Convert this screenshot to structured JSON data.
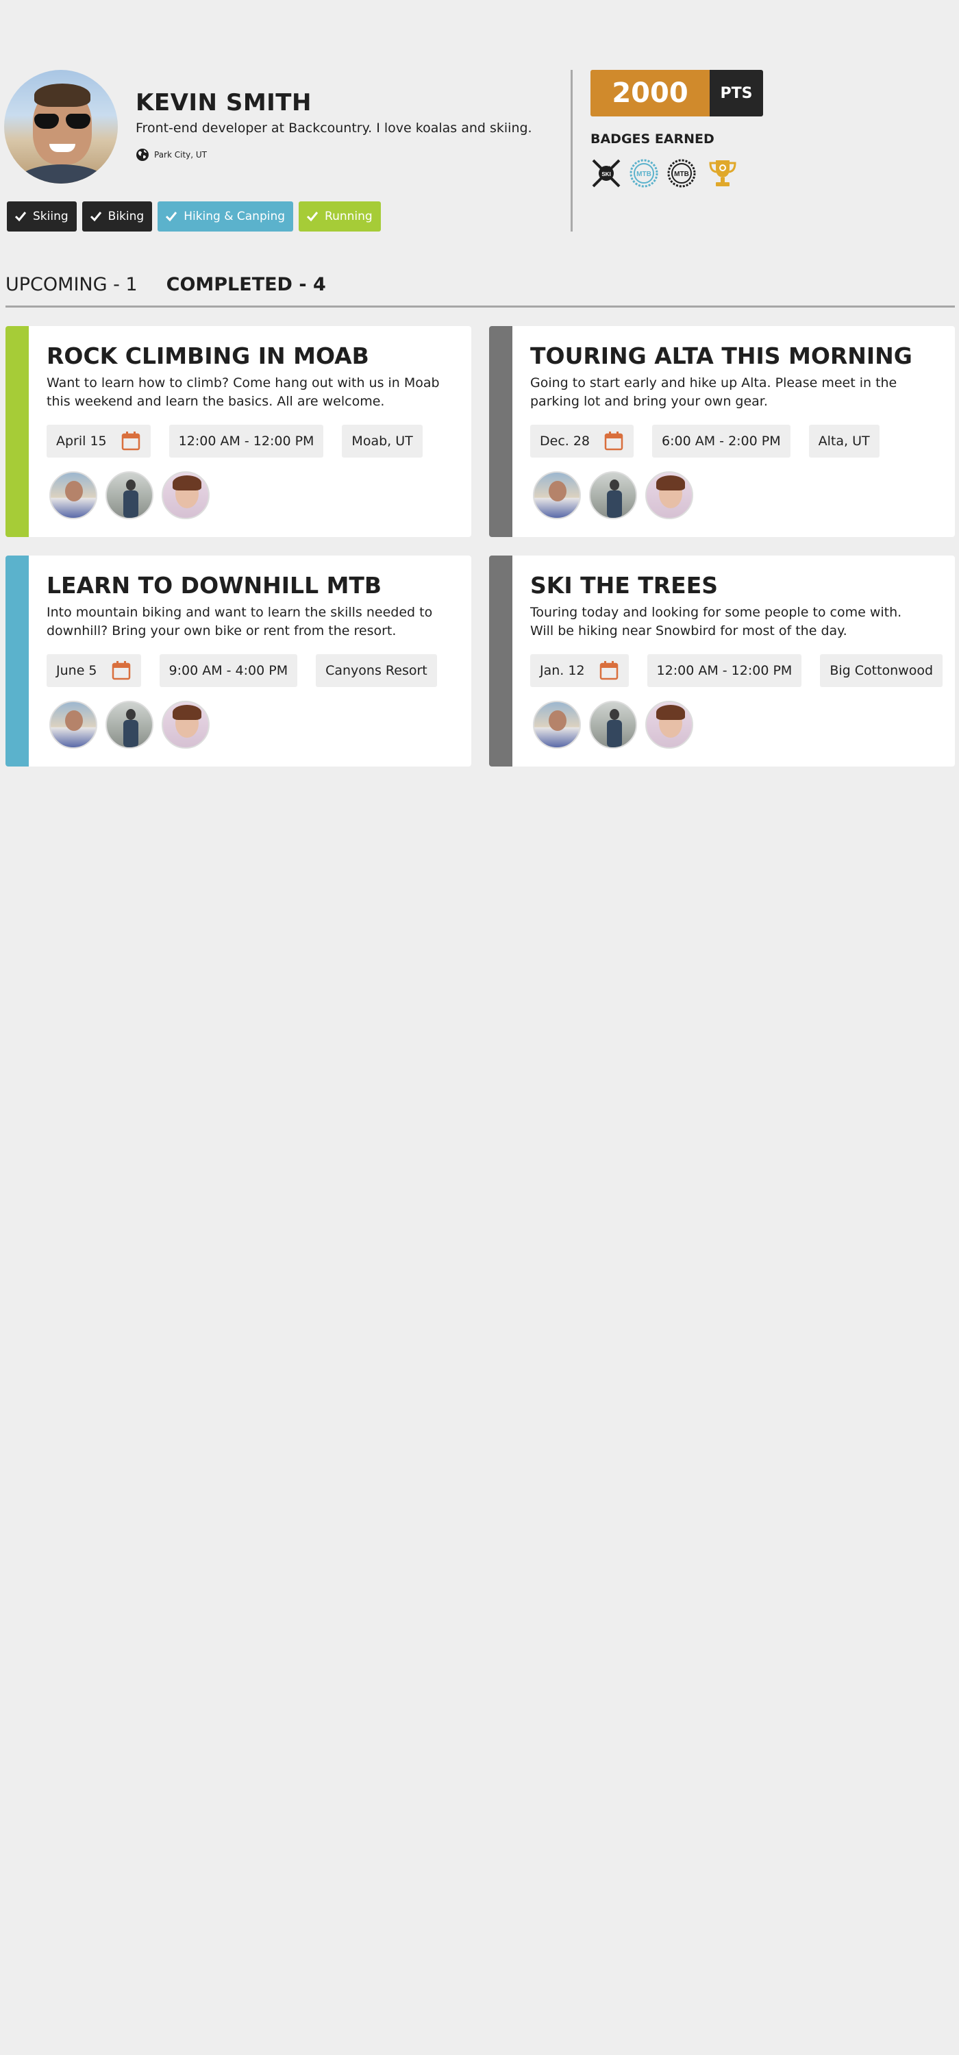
{
  "profile": {
    "name": "KEVIN SMITH",
    "bio": "Front-end developer at Backcountry. I love koalas and skiing.",
    "location": "Park City, UT",
    "interests": [
      {
        "label": "Skiing",
        "color": "#262626"
      },
      {
        "label": "Biking",
        "color": "#262626"
      },
      {
        "label": "Hiking & Canping",
        "color": "#5bb2cc"
      },
      {
        "label": "Running",
        "color": "#a6cc37"
      }
    ]
  },
  "stats": {
    "points": "2000",
    "points_unit": "PTS",
    "badges_title": "BADGES EARNED",
    "badges": [
      "ski-badge-icon",
      "mtb-badge-blue-icon",
      "mtb-badge-dark-icon",
      "trophy-icon"
    ]
  },
  "tabs": {
    "upcoming": "UPCOMING - 1",
    "completed": "COMPLETED - 4"
  },
  "events": [
    {
      "title": "ROCK CLIMBING IN MOAB",
      "description": "Want to learn how to climb? Come hang out with us in Moab this weekend and learn the basics. All are welcome.",
      "date": "April 15",
      "time": "12:00 AM - 12:00 PM",
      "location": "Moab, UT",
      "accent": "#a6cc37"
    },
    {
      "title": "TOURING ALTA THIS MORNING",
      "description": "Going to start early and hike up Alta. Please meet in the parking lot and bring your own gear.",
      "date": "Dec. 28",
      "time": "6:00 AM - 2:00 PM",
      "location": "Alta, UT",
      "accent": "#757575"
    },
    {
      "title": "LEARN TO DOWNHILL MTB",
      "description": "Into mountain biking and want to learn the skills needed to downhill? Bring your own bike or rent from the resort.",
      "date": "June 5",
      "time": "9:00 AM - 4:00 PM",
      "location": "Canyons Resort",
      "accent": "#5bb2cc"
    },
    {
      "title": "SKI THE TREES",
      "description": "Touring today and looking for some people to come with. Will be hiking near Snowbird for most of the day.",
      "date": "Jan. 12",
      "time": "12:00 AM - 12:00 PM",
      "location": "Big Cottonwood",
      "accent": "#757575"
    }
  ],
  "colors": {
    "points_bg": "#d08a2c",
    "calendar_icon": "#d96f3d",
    "background": "#eeeeee"
  }
}
